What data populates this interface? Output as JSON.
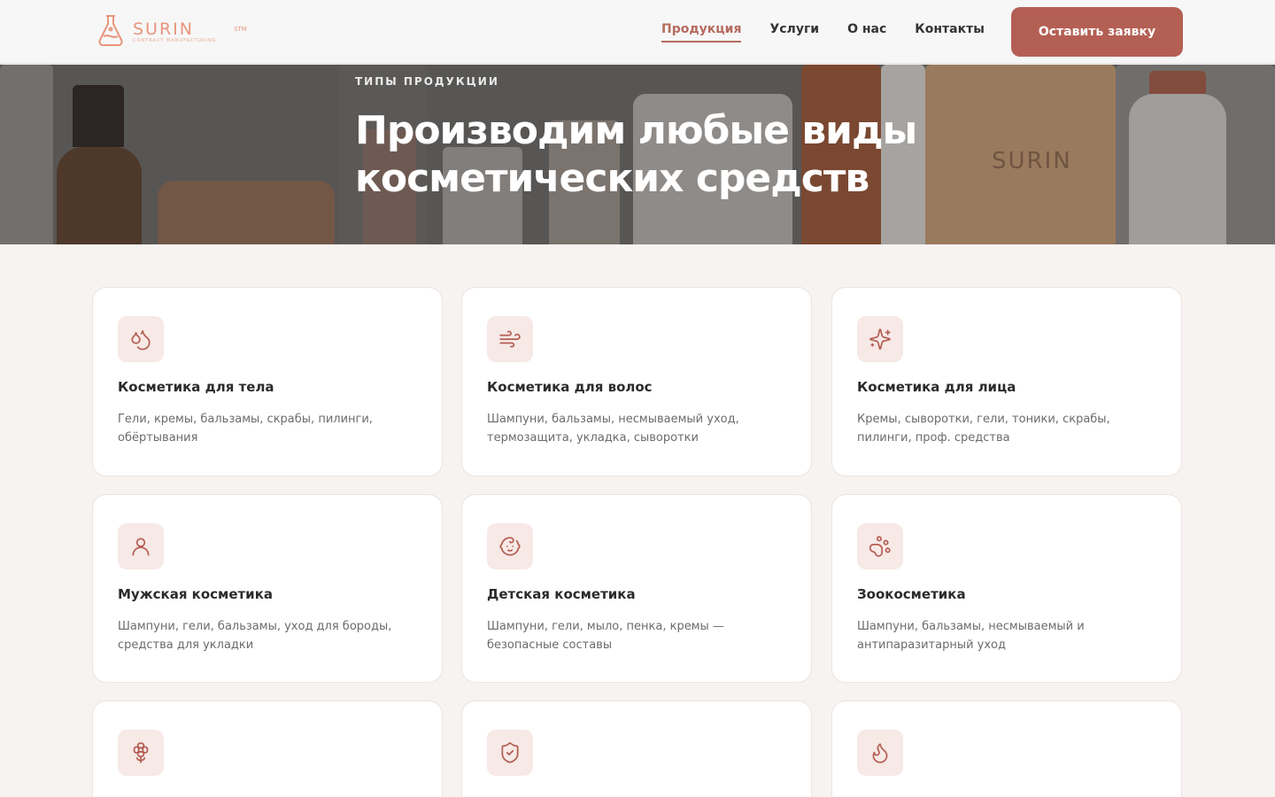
{
  "header": {
    "logo_word": "SURIN",
    "logo_stm": "STM",
    "logo_sub": "CONTRACT MANUFACTURING",
    "nav": [
      {
        "label": "Продукция",
        "active": true
      },
      {
        "label": "Услуги",
        "active": false
      },
      {
        "label": "О нас",
        "active": false
      },
      {
        "label": "Контакты",
        "active": false
      }
    ],
    "cta_label": "Оставить заявку"
  },
  "hero": {
    "tag": "ТИПЫ ПРОДУКЦИИ",
    "title": "Производим любые виды косметических средств"
  },
  "cards": [
    {
      "icon": "droplets-icon",
      "title": "Косметика для тела",
      "desc": "Гели, кремы, бальзамы, скрабы, пилинги, обёртывания"
    },
    {
      "icon": "wind-icon",
      "title": "Косметика для волос",
      "desc": "Шампуни, бальзамы, несмываемый уход, термозащита, укладка, сыворотки"
    },
    {
      "icon": "sparkles-icon",
      "title": "Косметика для лица",
      "desc": "Кремы, сыворотки, гели, тоники, скрабы, пилинги, проф. средства"
    },
    {
      "icon": "user-icon",
      "title": "Мужская косметика",
      "desc": "Шампуни, гели, бальзамы, уход для бороды, средства для укладки"
    },
    {
      "icon": "baby-icon",
      "title": "Детская косметика",
      "desc": "Шампуни, гели, мыло, пенка, кремы — безопасные составы"
    },
    {
      "icon": "paw-icon",
      "title": "Зоокосметика",
      "desc": "Шампуни, бальзамы, несмываемый и антипаразитарный уход"
    },
    {
      "icon": "flower-icon",
      "title": "",
      "desc": ""
    },
    {
      "icon": "shield-check-icon",
      "title": "",
      "desc": ""
    },
    {
      "icon": "flame-icon",
      "title": "",
      "desc": ""
    }
  ],
  "colors": {
    "accent": "#b45f54",
    "icon_bg": "#f7e9e6",
    "page_bg": "#f7f3f1"
  }
}
